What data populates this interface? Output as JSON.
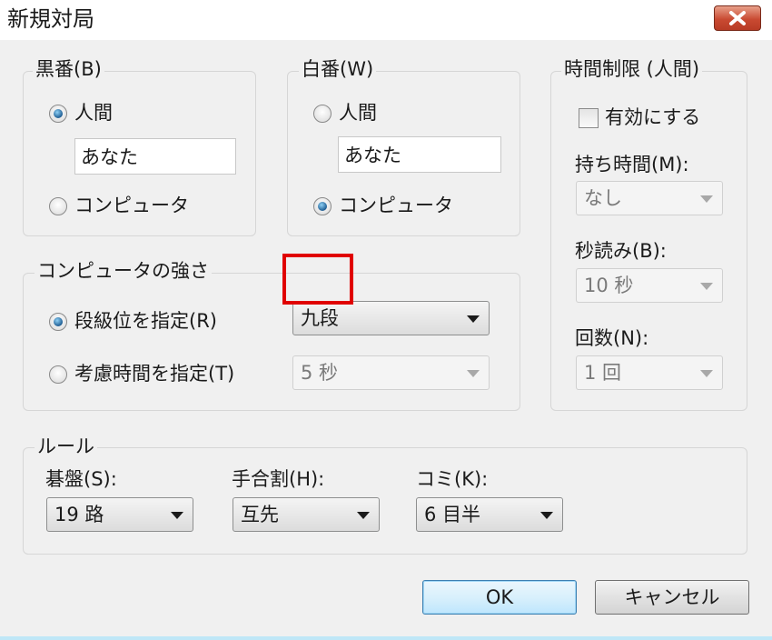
{
  "window": {
    "title": "新規対局"
  },
  "black": {
    "legend": "黒番(B)",
    "option_human": "人間",
    "option_computer": "コンピュータ",
    "selected": "human",
    "name_value": "あなた"
  },
  "white": {
    "legend": "白番(W)",
    "option_human": "人間",
    "option_computer": "コンピュータ",
    "selected": "computer",
    "name_value": "あなた"
  },
  "time_limit": {
    "legend": "時間制限 (人間)",
    "enable_label": "有効にする",
    "enabled": false,
    "hold_time_label": "持ち時間(M):",
    "hold_time_value": "なし",
    "byoyomi_label": "秒読み(B):",
    "byoyomi_value": "10 秒",
    "count_label": "回数(N):",
    "count_value": "1 回"
  },
  "strength": {
    "legend": "コンピュータの強さ",
    "by_rank_label": "段級位を指定(R)",
    "by_time_label": "考慮時間を指定(T)",
    "selected": "rank",
    "rank_value": "九段",
    "time_value": "5 秒"
  },
  "rules": {
    "legend": "ルール",
    "board_label": "碁盤(S):",
    "board_value": "19 路",
    "handicap_label": "手合割(H):",
    "handicap_value": "互先",
    "komi_label": "コミ(K):",
    "komi_value": "6 目半"
  },
  "buttons": {
    "ok": "OK",
    "cancel": "キャンセル"
  },
  "colors": {
    "highlight": "#e00000",
    "default_button_border": "#3c7fb1"
  }
}
